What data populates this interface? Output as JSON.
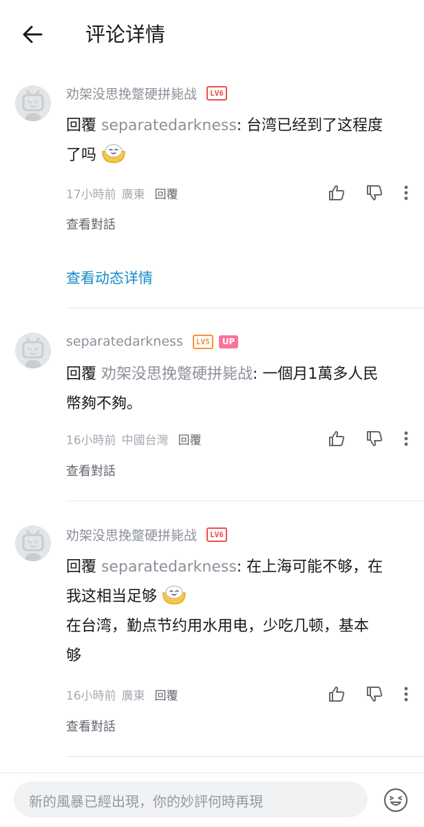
{
  "header": {
    "title": "评论详情"
  },
  "comments": [
    {
      "username": "劝架没思挽蹩硬拼毙战",
      "level": "LV6",
      "reply_prefix": "回覆",
      "mention": "separatedarkness",
      "text_line1": ": 台湾已经到了这程度",
      "text_line2": "了吗",
      "time": "17小時前",
      "location": "廣東",
      "reply_label": "回覆",
      "view_conversation": "查看對話"
    },
    {
      "username": "separatedarkness",
      "level": "LV5",
      "up_badge": "UP",
      "reply_prefix": "回覆",
      "mention": "劝架没思挽蹩硬拼毙战",
      "text_line1": ": 一個月1萬多人民",
      "text_line2": "幣夠不夠。",
      "time": "16小時前",
      "location": "中國台灣",
      "reply_label": "回覆",
      "view_conversation": "查看對話"
    },
    {
      "username": "劝架没思挽蹩硬拼毙战",
      "level": "LV6",
      "reply_prefix": "回覆",
      "mention": "separatedarkness",
      "text_line1": ": 在上海可能不够，在",
      "text_line2": "我这相当足够",
      "text_line3": "在台湾，勤点节约用水用电，少吃几顿，基本",
      "text_line4": "够",
      "time": "16小時前",
      "location": "廣東",
      "reply_label": "回覆",
      "view_conversation": "查看對話"
    }
  ],
  "view_dynamic": "查看动态详情",
  "input": {
    "placeholder": "新的風暴已經出現，你的妙評何時再現"
  },
  "colors": {
    "link": "#178bc7",
    "level6": "#f04c49",
    "level5": "#ff8c37",
    "up": "#fb7299",
    "muted": "#8b9099"
  }
}
